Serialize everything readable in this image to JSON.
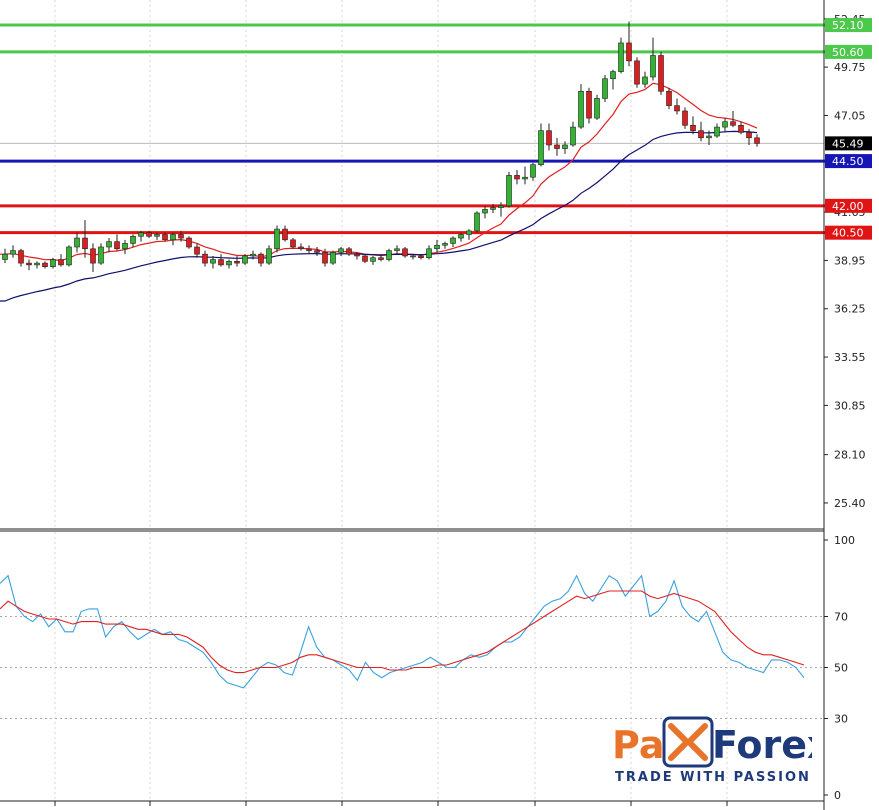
{
  "chart_data": [
    {
      "type": "candlestick",
      "ylim": [
        24.0,
        53.5
      ],
      "y_ticks": [
        "52.45",
        "49.75",
        "47.05",
        "41.65",
        "38.95",
        "36.25",
        "33.55",
        "30.85",
        "28.10",
        "25.40"
      ],
      "current_price": {
        "value": 45.49,
        "label": "45.49"
      },
      "levels": [
        {
          "name": "resistance",
          "value": 52.1,
          "label": "52.10",
          "color": "#4cc84a"
        },
        {
          "name": "resistance",
          "value": 50.6,
          "label": "50.60",
          "color": "#4cc84a"
        },
        {
          "name": "support",
          "value": 44.5,
          "label": "44.50",
          "color": "#1616b4"
        },
        {
          "name": "support",
          "value": 42.0,
          "label": "42.00",
          "color": "#e01414"
        },
        {
          "name": "support",
          "value": 40.5,
          "label": "40.50",
          "color": "#e01414"
        }
      ],
      "candles": [
        [
          39.0,
          39.6,
          38.8,
          39.3
        ],
        [
          39.3,
          39.8,
          39.1,
          39.5
        ],
        [
          39.5,
          39.6,
          38.6,
          38.8
        ],
        [
          38.8,
          39.0,
          38.4,
          38.7
        ],
        [
          38.7,
          38.9,
          38.5,
          38.8
        ],
        [
          38.8,
          38.9,
          38.5,
          38.6
        ],
        [
          38.6,
          39.1,
          38.5,
          39.0
        ],
        [
          39.0,
          39.3,
          38.6,
          38.7
        ],
        [
          38.7,
          39.8,
          38.6,
          39.7
        ],
        [
          39.7,
          40.5,
          39.4,
          40.2
        ],
        [
          40.2,
          41.2,
          39.1,
          39.6
        ],
        [
          39.6,
          39.9,
          38.3,
          38.8
        ],
        [
          38.8,
          39.9,
          38.7,
          39.7
        ],
        [
          39.7,
          40.2,
          39.4,
          40.0
        ],
        [
          40.0,
          40.4,
          39.5,
          39.6
        ],
        [
          39.6,
          40.1,
          39.3,
          39.9
        ],
        [
          39.9,
          40.4,
          39.7,
          40.3
        ],
        [
          40.3,
          40.6,
          40.0,
          40.5
        ],
        [
          40.5,
          40.6,
          40.2,
          40.3
        ],
        [
          40.3,
          40.5,
          40.1,
          40.4
        ],
        [
          40.4,
          40.5,
          40.0,
          40.1
        ],
        [
          40.1,
          40.5,
          39.8,
          40.4
        ],
        [
          40.4,
          40.6,
          40.0,
          40.2
        ],
        [
          40.2,
          40.3,
          39.6,
          39.7
        ],
        [
          39.7,
          39.9,
          39.1,
          39.3
        ],
        [
          39.3,
          39.5,
          38.6,
          38.8
        ],
        [
          38.8,
          39.2,
          38.5,
          39.0
        ],
        [
          39.0,
          39.3,
          38.6,
          38.7
        ],
        [
          38.7,
          39.0,
          38.5,
          38.9
        ],
        [
          38.9,
          39.2,
          38.6,
          38.8
        ],
        [
          38.8,
          39.3,
          38.7,
          39.2
        ],
        [
          39.2,
          39.5,
          39.0,
          39.3
        ],
        [
          39.3,
          39.4,
          38.6,
          38.8
        ],
        [
          38.8,
          39.8,
          38.7,
          39.6
        ],
        [
          39.6,
          40.9,
          39.4,
          40.7
        ],
        [
          40.7,
          40.9,
          40.0,
          40.1
        ],
        [
          40.1,
          40.2,
          39.6,
          39.7
        ],
        [
          39.7,
          39.9,
          39.5,
          39.6
        ],
        [
          39.6,
          39.8,
          39.3,
          39.5
        ],
        [
          39.5,
          39.7,
          39.2,
          39.4
        ],
        [
          39.4,
          39.6,
          38.6,
          38.8
        ],
        [
          38.8,
          39.5,
          38.7,
          39.4
        ],
        [
          39.4,
          39.7,
          39.2,
          39.6
        ],
        [
          39.6,
          39.7,
          39.2,
          39.3
        ],
        [
          39.3,
          39.4,
          39.0,
          39.2
        ],
        [
          39.2,
          39.3,
          38.8,
          38.9
        ],
        [
          38.9,
          39.2,
          38.7,
          39.1
        ],
        [
          39.1,
          39.3,
          38.9,
          39.0
        ],
        [
          39.0,
          39.6,
          38.9,
          39.5
        ],
        [
          39.5,
          39.8,
          39.3,
          39.6
        ],
        [
          39.6,
          39.7,
          39.1,
          39.2
        ],
        [
          39.2,
          39.3,
          39.0,
          39.2
        ],
        [
          39.2,
          39.3,
          39.0,
          39.1
        ],
        [
          39.1,
          39.8,
          39.0,
          39.6
        ],
        [
          39.6,
          40.1,
          39.4,
          39.8
        ],
        [
          39.8,
          40.0,
          39.6,
          39.9
        ],
        [
          39.9,
          40.3,
          39.7,
          40.2
        ],
        [
          40.2,
          40.5,
          40.0,
          40.4
        ],
        [
          40.4,
          40.7,
          40.1,
          40.6
        ],
        [
          40.6,
          41.7,
          40.5,
          41.6
        ],
        [
          41.6,
          42.0,
          41.3,
          41.8
        ],
        [
          41.8,
          42.1,
          41.6,
          41.9
        ],
        [
          41.9,
          42.2,
          41.4,
          42.0
        ],
        [
          42.0,
          43.9,
          41.9,
          43.7
        ],
        [
          43.7,
          44.0,
          43.2,
          43.5
        ],
        [
          43.5,
          44.2,
          43.2,
          43.6
        ],
        [
          43.6,
          44.4,
          43.4,
          44.3
        ],
        [
          44.3,
          46.6,
          44.2,
          46.2
        ],
        [
          46.2,
          46.6,
          45.1,
          45.4
        ],
        [
          45.4,
          45.8,
          44.8,
          45.2
        ],
        [
          45.2,
          45.6,
          44.9,
          45.4
        ],
        [
          45.4,
          46.7,
          45.3,
          46.4
        ],
        [
          46.4,
          48.8,
          46.3,
          48.4
        ],
        [
          48.4,
          48.6,
          46.6,
          46.9
        ],
        [
          46.9,
          48.2,
          46.8,
          48.0
        ],
        [
          48.0,
          49.3,
          47.8,
          49.1
        ],
        [
          49.1,
          49.6,
          48.5,
          49.5
        ],
        [
          49.5,
          51.4,
          49.4,
          51.1
        ],
        [
          51.1,
          52.3,
          49.8,
          50.1
        ],
        [
          50.1,
          50.3,
          48.6,
          48.8
        ],
        [
          48.8,
          49.5,
          48.6,
          49.2
        ],
        [
          49.2,
          51.4,
          49.0,
          50.4
        ],
        [
          50.4,
          50.6,
          48.2,
          48.4
        ],
        [
          48.4,
          48.6,
          47.4,
          47.6
        ],
        [
          47.6,
          48.0,
          47.1,
          47.3
        ],
        [
          47.3,
          47.5,
          46.3,
          46.5
        ],
        [
          46.5,
          47.0,
          46.0,
          46.2
        ],
        [
          46.2,
          46.7,
          45.6,
          45.8
        ],
        [
          45.8,
          46.2,
          45.4,
          45.9
        ],
        [
          45.9,
          46.6,
          45.8,
          46.4
        ],
        [
          46.4,
          46.9,
          46.1,
          46.7
        ],
        [
          46.7,
          47.3,
          46.4,
          46.5
        ],
        [
          46.5,
          46.7,
          46.0,
          46.1
        ],
        [
          46.1,
          46.3,
          45.4,
          45.8
        ],
        [
          45.8,
          46.0,
          45.3,
          45.49
        ]
      ],
      "moving_averages": [
        {
          "period": 10,
          "color": "#e02020"
        },
        {
          "period": 30,
          "color": "#10106e",
          "seed": 36.5
        }
      ]
    },
    {
      "type": "line",
      "ylim": [
        0,
        100
      ],
      "y_ticks": [
        "100",
        "70",
        "50",
        "30",
        "0"
      ],
      "reference_levels": [
        70,
        50,
        30
      ],
      "series": [
        {
          "color": "#3aa0e0",
          "values": [
            83,
            86,
            74,
            70,
            68,
            71,
            66,
            69,
            64,
            64,
            72,
            73,
            73,
            62,
            66,
            68,
            64,
            61,
            63,
            65,
            63,
            64,
            61,
            60,
            58,
            56,
            52,
            47,
            44,
            43,
            42,
            46,
            50,
            52,
            51,
            48,
            47,
            56,
            66,
            58,
            54,
            53,
            51,
            49,
            45,
            52,
            48,
            46,
            48,
            49,
            50,
            51,
            52,
            54,
            52,
            50,
            50,
            53,
            55,
            54,
            55,
            58,
            60,
            60,
            62,
            66,
            70,
            74,
            76,
            77,
            80,
            86,
            79,
            76,
            81,
            86,
            84,
            78,
            82,
            86,
            70,
            72,
            76,
            84,
            74,
            70,
            68,
            72,
            64,
            56,
            53,
            52,
            50,
            49,
            48,
            53,
            53,
            52,
            50,
            46
          ]
        },
        {
          "color": "#e02020",
          "values": [
            73,
            76,
            74,
            72,
            71,
            70,
            69,
            69,
            68,
            67,
            68,
            68,
            68,
            67,
            67,
            67,
            66,
            65,
            65,
            64,
            63,
            63,
            63,
            62,
            60,
            58,
            54,
            51,
            49,
            48,
            48,
            49,
            50,
            50,
            50,
            51,
            52,
            54,
            55,
            55,
            54,
            53,
            52,
            51,
            50,
            50,
            50,
            50,
            49,
            49,
            49,
            50,
            50,
            50,
            51,
            51,
            52,
            53,
            54,
            55,
            56,
            58,
            60,
            62,
            64,
            66,
            68,
            70,
            72,
            74,
            76,
            78,
            77,
            78,
            79,
            80,
            80,
            80,
            80,
            80,
            78,
            77,
            78,
            79,
            78,
            77,
            76,
            74,
            72,
            68,
            64,
            61,
            58,
            56,
            55,
            55,
            54,
            53,
            52,
            51
          ]
        }
      ]
    }
  ],
  "watermark": {
    "brand": "PaxForex",
    "tagline": "TRADE WITH PASSION"
  }
}
